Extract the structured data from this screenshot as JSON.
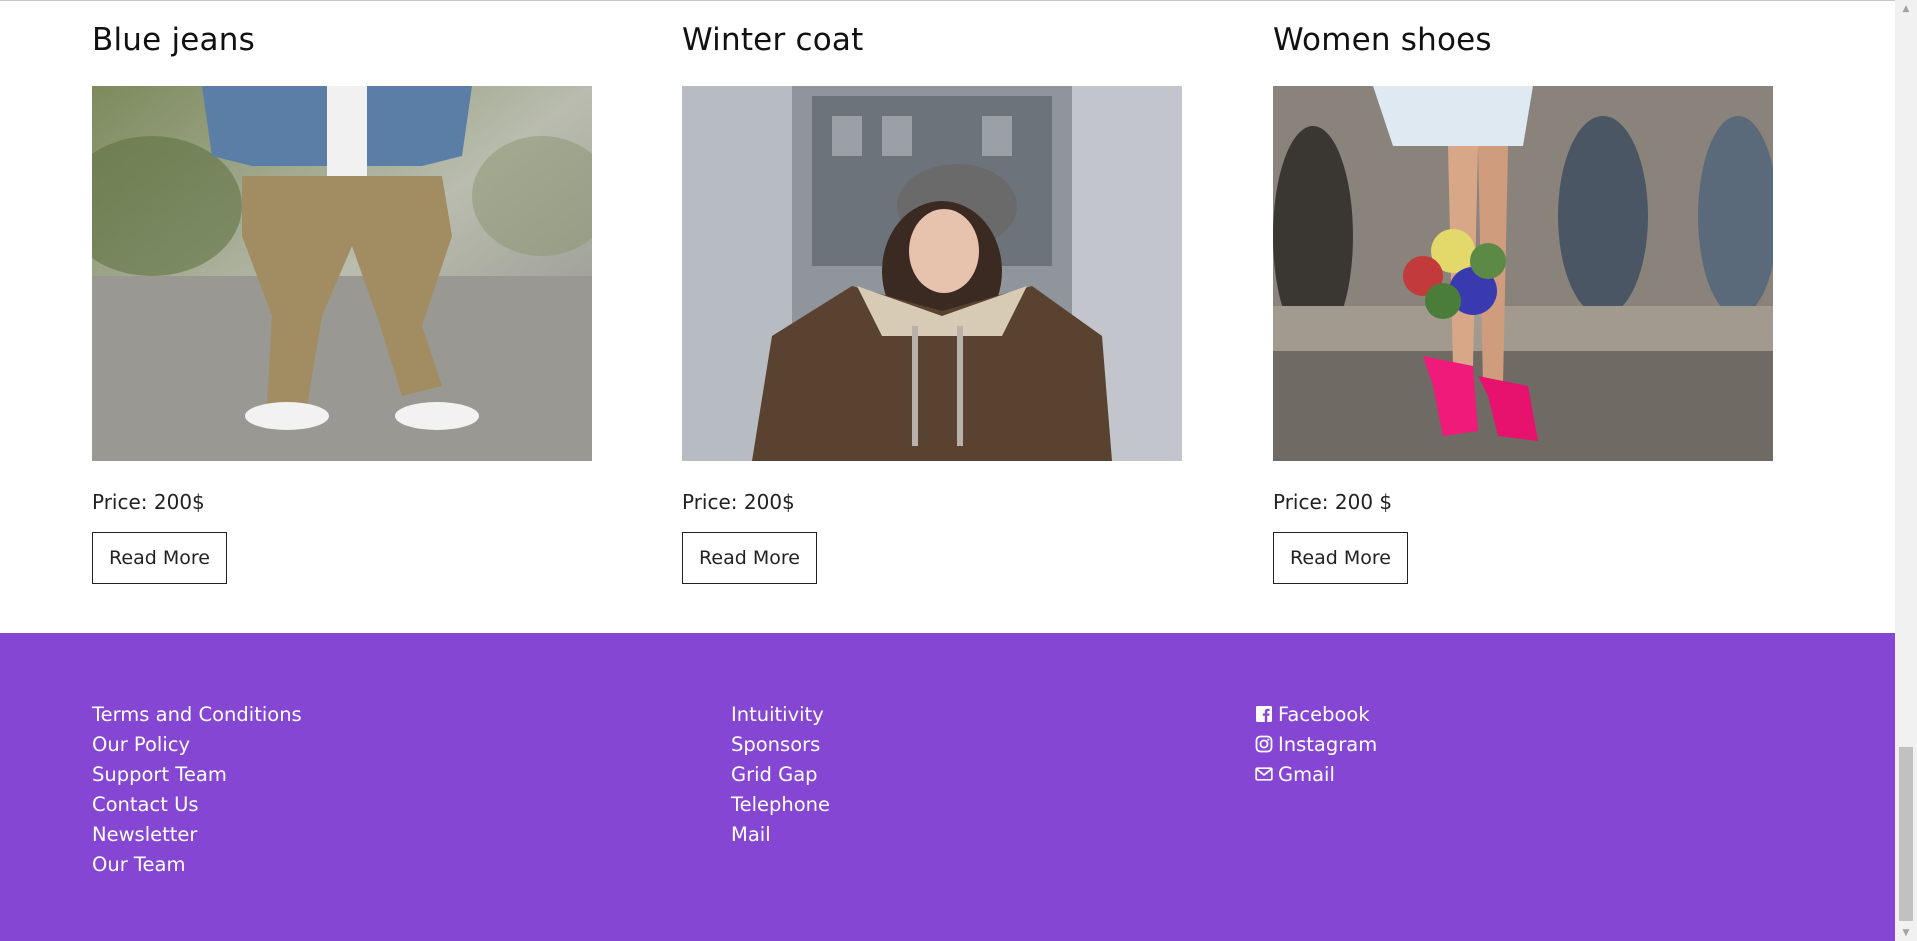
{
  "products": [
    {
      "title": "Blue jeans",
      "price": "Price: 200$",
      "button": "Read More",
      "image": "photo-blue-jeans-model"
    },
    {
      "title": "Winter coat",
      "price": "Price: 200$",
      "button": "Read More",
      "image": "photo-winter-coat-model"
    },
    {
      "title": "Women shoes",
      "price": "Price: 200 $",
      "button": "Read More",
      "image": "photo-women-shoes"
    }
  ],
  "footer": {
    "col1": [
      "Terms and Conditions",
      "Our Policy",
      "Support Team",
      "Contact Us",
      "Newsletter",
      "Our Team"
    ],
    "col2": [
      "Intuitivity",
      "Sponsors",
      "Grid Gap",
      "Telephone",
      "Mail"
    ],
    "social": [
      {
        "label": "Facebook",
        "icon": "facebook-icon"
      },
      {
        "label": "Instagram",
        "icon": "instagram-icon"
      },
      {
        "label": "Gmail",
        "icon": "envelope-icon"
      }
    ],
    "background": "#8546d4"
  }
}
